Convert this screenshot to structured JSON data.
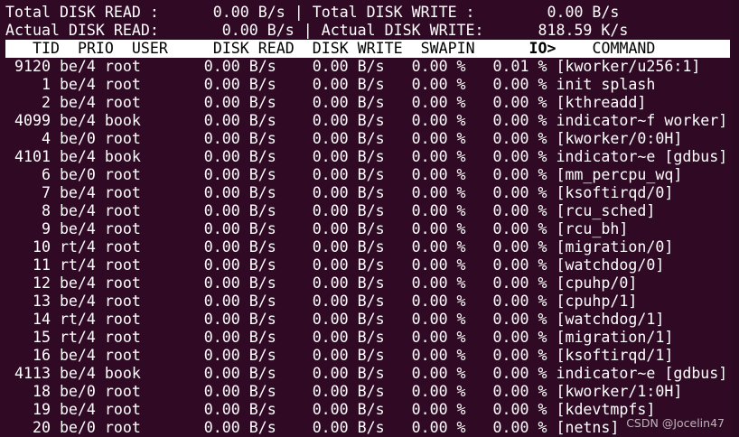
{
  "theme": {
    "terminal_bg": "#300a24",
    "header_bg": "#ffffff",
    "text": "#ffffff"
  },
  "summary": {
    "total_read_label": "Total DISK READ :",
    "total_read_value": "0.00 B/s",
    "total_write_label": "Total DISK WRITE :",
    "total_write_value": "0.00 B/s",
    "actual_read_label": "Actual DISK READ:",
    "actual_read_value": "0.00 B/s",
    "actual_write_label": "Actual DISK WRITE:",
    "actual_write_value": "818.59 K/s"
  },
  "columns": {
    "tid": "TID",
    "prio": "PRIO",
    "user": "USER",
    "disk_read": "DISK READ",
    "disk_write": "DISK WRITE",
    "swapin": "SWAPIN",
    "io": "IO>",
    "command": "COMMAND"
  },
  "processes": [
    {
      "tid": "9120",
      "prio": "be/4",
      "user": "root",
      "read": "0.00 B/s",
      "write": "0.00 B/s",
      "swapin": "0.00 %",
      "io": "0.01 %",
      "command": "[kworker/u256:1]"
    },
    {
      "tid": "1",
      "prio": "be/4",
      "user": "root",
      "read": "0.00 B/s",
      "write": "0.00 B/s",
      "swapin": "0.00 %",
      "io": "0.00 %",
      "command": "init splash"
    },
    {
      "tid": "2",
      "prio": "be/4",
      "user": "root",
      "read": "0.00 B/s",
      "write": "0.00 B/s",
      "swapin": "0.00 %",
      "io": "0.00 %",
      "command": "[kthreadd]"
    },
    {
      "tid": "4099",
      "prio": "be/4",
      "user": "book",
      "read": "0.00 B/s",
      "write": "0.00 B/s",
      "swapin": "0.00 %",
      "io": "0.00 %",
      "command": "indicator~f worker]"
    },
    {
      "tid": "4",
      "prio": "be/0",
      "user": "root",
      "read": "0.00 B/s",
      "write": "0.00 B/s",
      "swapin": "0.00 %",
      "io": "0.00 %",
      "command": "[kworker/0:0H]"
    },
    {
      "tid": "4101",
      "prio": "be/4",
      "user": "book",
      "read": "0.00 B/s",
      "write": "0.00 B/s",
      "swapin": "0.00 %",
      "io": "0.00 %",
      "command": "indicator~e [gdbus]"
    },
    {
      "tid": "6",
      "prio": "be/0",
      "user": "root",
      "read": "0.00 B/s",
      "write": "0.00 B/s",
      "swapin": "0.00 %",
      "io": "0.00 %",
      "command": "[mm_percpu_wq]"
    },
    {
      "tid": "7",
      "prio": "be/4",
      "user": "root",
      "read": "0.00 B/s",
      "write": "0.00 B/s",
      "swapin": "0.00 %",
      "io": "0.00 %",
      "command": "[ksoftirqd/0]"
    },
    {
      "tid": "8",
      "prio": "be/4",
      "user": "root",
      "read": "0.00 B/s",
      "write": "0.00 B/s",
      "swapin": "0.00 %",
      "io": "0.00 %",
      "command": "[rcu_sched]"
    },
    {
      "tid": "9",
      "prio": "be/4",
      "user": "root",
      "read": "0.00 B/s",
      "write": "0.00 B/s",
      "swapin": "0.00 %",
      "io": "0.00 %",
      "command": "[rcu_bh]"
    },
    {
      "tid": "10",
      "prio": "rt/4",
      "user": "root",
      "read": "0.00 B/s",
      "write": "0.00 B/s",
      "swapin": "0.00 %",
      "io": "0.00 %",
      "command": "[migration/0]"
    },
    {
      "tid": "11",
      "prio": "rt/4",
      "user": "root",
      "read": "0.00 B/s",
      "write": "0.00 B/s",
      "swapin": "0.00 %",
      "io": "0.00 %",
      "command": "[watchdog/0]"
    },
    {
      "tid": "12",
      "prio": "be/4",
      "user": "root",
      "read": "0.00 B/s",
      "write": "0.00 B/s",
      "swapin": "0.00 %",
      "io": "0.00 %",
      "command": "[cpuhp/0]"
    },
    {
      "tid": "13",
      "prio": "be/4",
      "user": "root",
      "read": "0.00 B/s",
      "write": "0.00 B/s",
      "swapin": "0.00 %",
      "io": "0.00 %",
      "command": "[cpuhp/1]"
    },
    {
      "tid": "14",
      "prio": "rt/4",
      "user": "root",
      "read": "0.00 B/s",
      "write": "0.00 B/s",
      "swapin": "0.00 %",
      "io": "0.00 %",
      "command": "[watchdog/1]"
    },
    {
      "tid": "15",
      "prio": "rt/4",
      "user": "root",
      "read": "0.00 B/s",
      "write": "0.00 B/s",
      "swapin": "0.00 %",
      "io": "0.00 %",
      "command": "[migration/1]"
    },
    {
      "tid": "16",
      "prio": "be/4",
      "user": "root",
      "read": "0.00 B/s",
      "write": "0.00 B/s",
      "swapin": "0.00 %",
      "io": "0.00 %",
      "command": "[ksoftirqd/1]"
    },
    {
      "tid": "4113",
      "prio": "be/4",
      "user": "book",
      "read": "0.00 B/s",
      "write": "0.00 B/s",
      "swapin": "0.00 %",
      "io": "0.00 %",
      "command": "indicator~e [gdbus]"
    },
    {
      "tid": "18",
      "prio": "be/0",
      "user": "root",
      "read": "0.00 B/s",
      "write": "0.00 B/s",
      "swapin": "0.00 %",
      "io": "0.00 %",
      "command": "[kworker/1:0H]"
    },
    {
      "tid": "19",
      "prio": "be/4",
      "user": "root",
      "read": "0.00 B/s",
      "write": "0.00 B/s",
      "swapin": "0.00 %",
      "io": "0.00 %",
      "command": "[kdevtmpfs]"
    },
    {
      "tid": "20",
      "prio": "be/0",
      "user": "root",
      "read": "0.00 B/s",
      "write": "0.00 B/s",
      "swapin": "0.00 %",
      "io": "0.00 %",
      "command": "[netns]"
    }
  ],
  "watermark": "CSDN @Jocelin47"
}
